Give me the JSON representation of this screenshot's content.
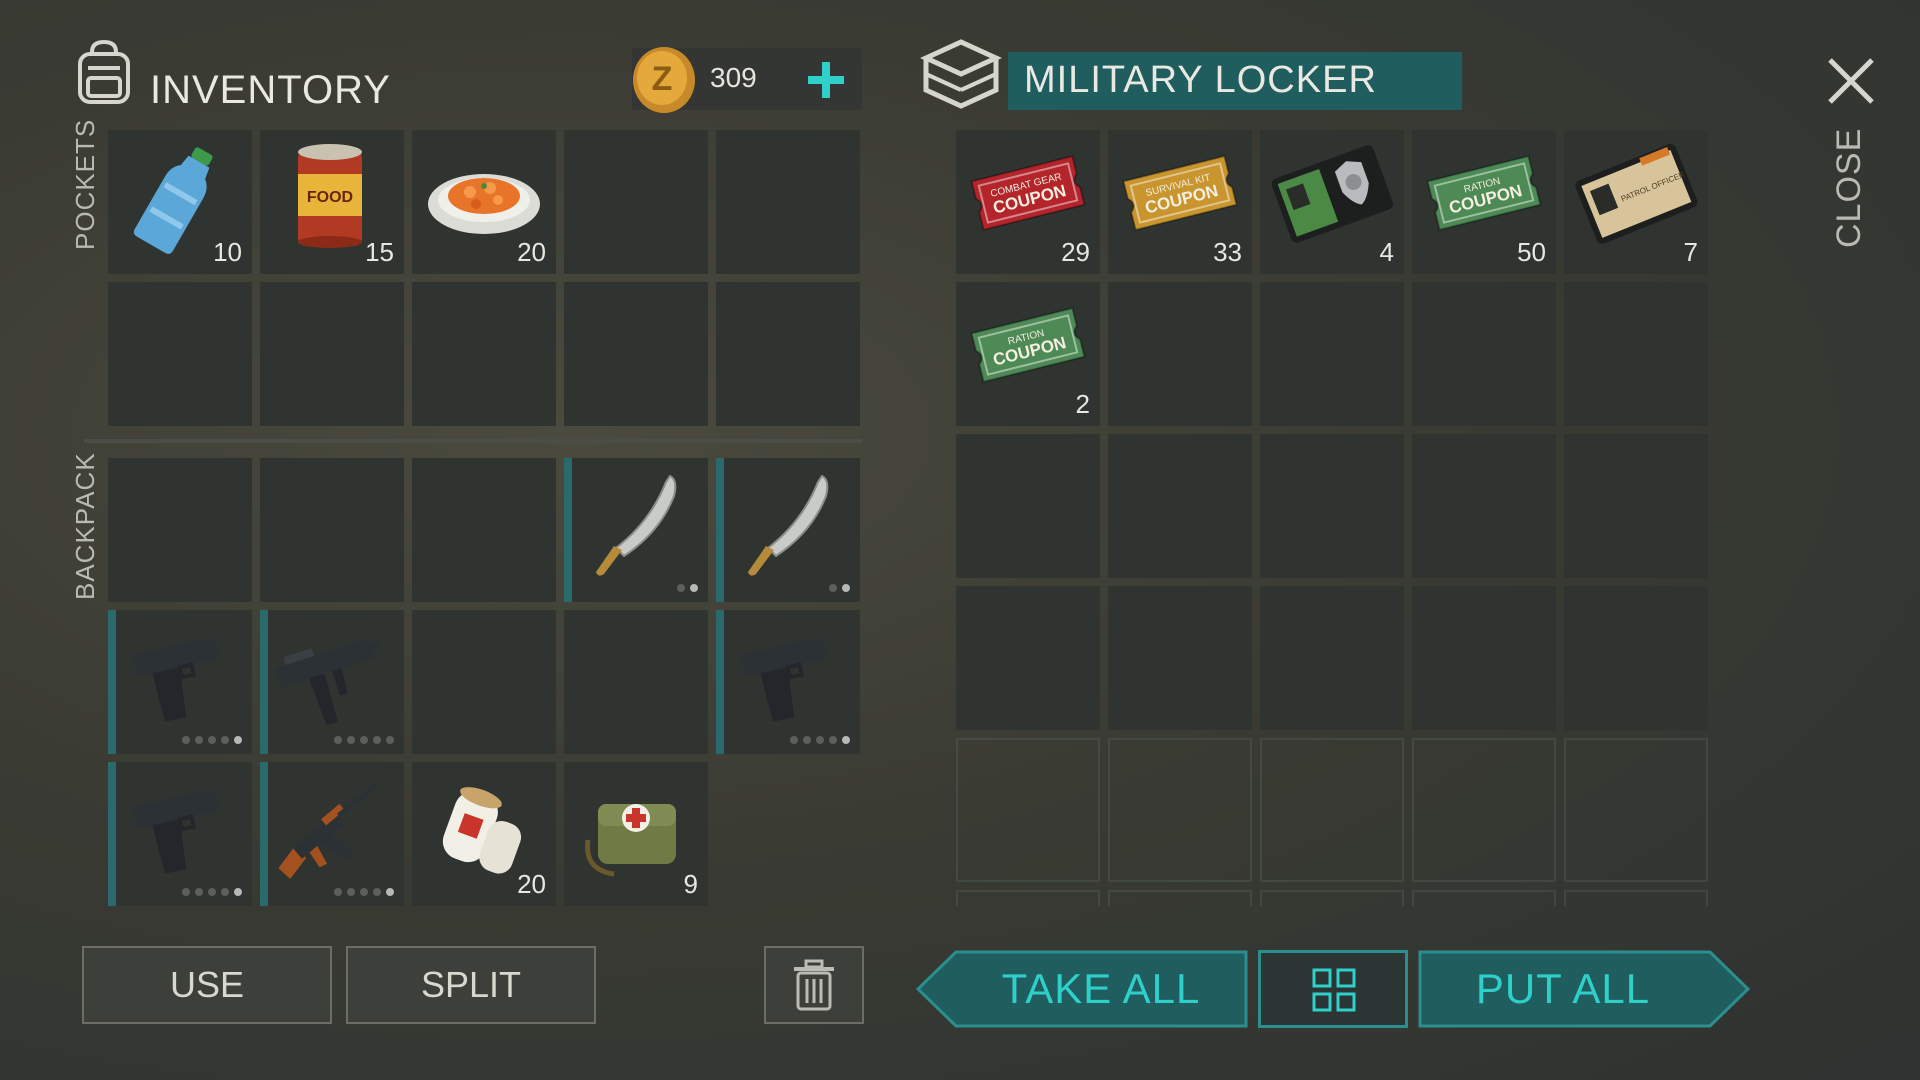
{
  "inventory": {
    "title": "INVENTORY",
    "coins": "309",
    "pockets_label": "POCKETS",
    "backpack_label": "BACKPACK",
    "pockets": [
      {
        "name": "water-bottle",
        "count": "10"
      },
      {
        "name": "canned-food",
        "count": "15"
      },
      {
        "name": "carrot-dish",
        "count": "20"
      },
      {},
      {},
      {},
      {},
      {},
      {},
      {}
    ],
    "backpack": [
      {},
      {},
      {},
      {
        "name": "machete",
        "dots": [
          false,
          true
        ]
      },
      {
        "name": "machete",
        "dots": [
          false,
          true
        ]
      },
      {
        "name": "pistol",
        "dots": [
          false,
          false,
          false,
          false,
          true
        ]
      },
      {
        "name": "uzi",
        "dots": [
          false,
          false,
          false,
          false,
          false
        ]
      },
      {},
      {},
      {
        "name": "pistol",
        "dots": [
          false,
          false,
          false,
          false,
          true
        ]
      },
      {
        "name": "pistol",
        "dots": [
          false,
          false,
          false,
          false,
          true
        ]
      },
      {
        "name": "assault-rifle",
        "dots": [
          false,
          false,
          false,
          false,
          true
        ]
      },
      {
        "name": "bandages",
        "count": "20"
      },
      {
        "name": "first-aid-bag",
        "count": "9"
      }
    ],
    "use_label": "USE",
    "split_label": "SPLIT"
  },
  "locker": {
    "title": "MILITARY LOCKER",
    "items": [
      {
        "name": "combat-gear-coupon",
        "text1": "COMBAT GEAR",
        "text2": "COUPON",
        "count": "29",
        "color": "#b3242b"
      },
      {
        "name": "survival-kit-coupon",
        "text1": "SURVIVAL KIT",
        "text2": "COUPON",
        "count": "33",
        "color": "#c9952e"
      },
      {
        "name": "police-badge-wallet",
        "count": "4"
      },
      {
        "name": "ration-coupon",
        "text1": "RATION",
        "text2": "COUPON",
        "count": "50",
        "color": "#4d8a55"
      },
      {
        "name": "patrol-officer-id",
        "badge_text": "PATROL OFFICER",
        "count": "7"
      },
      {
        "name": "ration-coupon",
        "text1": "RATION",
        "text2": "COUPON",
        "count": "2",
        "color": "#4d8a55"
      }
    ],
    "take_all_label": "TAKE ALL",
    "put_all_label": "PUT ALL"
  },
  "close_label": "CLOSE",
  "colors": {
    "accent": "#2fd0c9",
    "teal_dark": "#1f5d5e",
    "slot": "#2f3431"
  }
}
